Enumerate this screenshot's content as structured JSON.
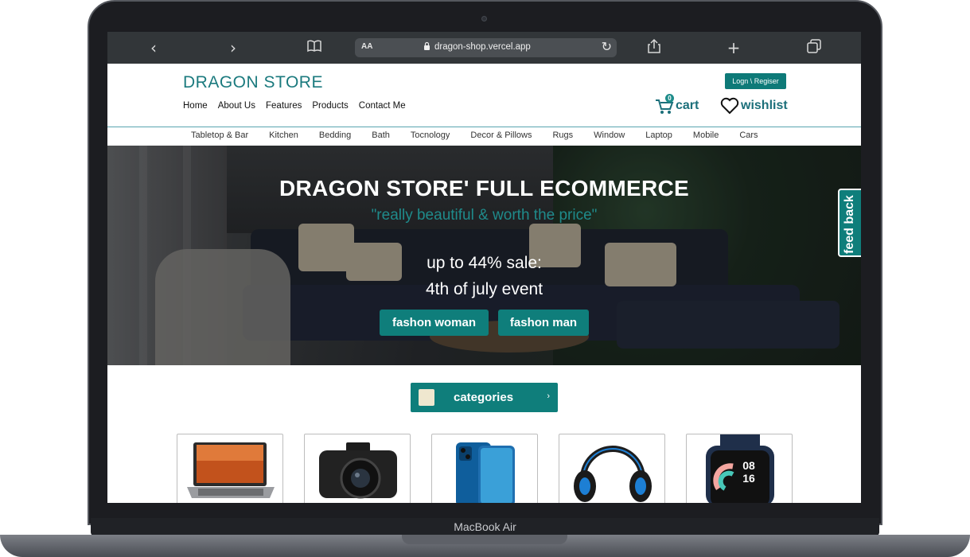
{
  "device": {
    "brand": "MacBook Air"
  },
  "browser": {
    "aa": "AA",
    "url": "dragon-shop.vercel.app",
    "icons": [
      "back-icon",
      "forward-icon",
      "book-icon",
      "lock-icon",
      "reload-icon",
      "share-icon",
      "plus-icon",
      "tabs-icon"
    ]
  },
  "header": {
    "title": "DRAGON STORE",
    "login": "Logn \\ Regiser",
    "nav": [
      "Home",
      "About Us",
      "Features",
      "Products",
      "Contact Me"
    ],
    "cart_label": "cart",
    "cart_count": "0",
    "wishlist_label": "wishlist"
  },
  "categories_bar": [
    "Tabletop & Bar",
    "Kitchen",
    "Bedding",
    "Bath",
    "Tocnology",
    "Decor & Pillows",
    "Rugs",
    "Window",
    "Laptop",
    "Mobile",
    "Cars"
  ],
  "hero": {
    "title": "DRAGON STORE' FULL ECOMMERCE",
    "quote": "\"really beautiful & worth the price\"",
    "sale": "up to 44% sale:",
    "event": "4th of july event",
    "btn_woman": "fashon woman",
    "btn_man": "fashon man",
    "feedback": "feed back"
  },
  "categories_button": {
    "label": "categories",
    "arrow": "›"
  },
  "products": [
    "laptop",
    "camera",
    "phone",
    "headset",
    "smartwatch"
  ],
  "watch_time": [
    "08",
    "16"
  ],
  "colors": {
    "accent": "#0f7e7b",
    "title": "#1b7a7e"
  }
}
